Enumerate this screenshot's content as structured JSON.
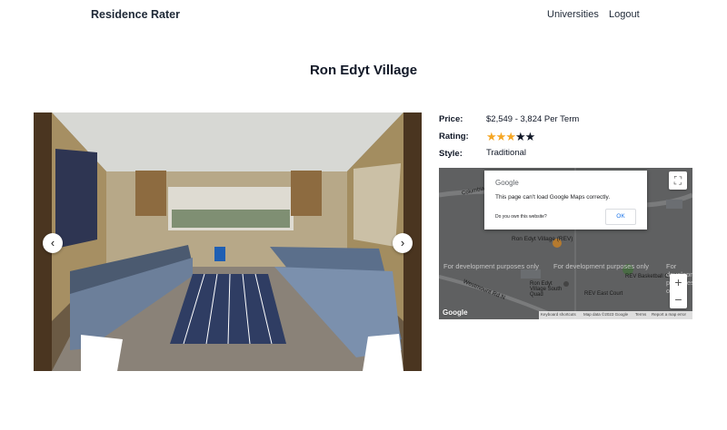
{
  "nav": {
    "brand": "Residence Rater",
    "links": [
      "Universities",
      "Logout"
    ]
  },
  "page": {
    "title": "Ron Edyt Village"
  },
  "carousel": {
    "prev_label": "‹",
    "next_label": "›"
  },
  "details": {
    "price_label": "Price:",
    "price_value": "$2,549 - 3,824 Per Term",
    "rating_label": "Rating:",
    "rating": 3,
    "rating_max": 5,
    "style_label": "Style:",
    "style_value": "Traditional"
  },
  "colors": {
    "star_filled": "#f5a623",
    "star_empty": "#111827"
  },
  "map": {
    "dialog": {
      "brand": "Google",
      "message": "This page can't load Google Maps correctly.",
      "own_site": "Do you own this website?",
      "ok": "OK"
    },
    "dev_watermark": "For development purposes only",
    "places": {
      "village": "Ron Edyt Village (REV)",
      "south_quad": "Ron Edyt Village South Quad",
      "east_court": "REV East Court",
      "basketball": "REV Basketball C"
    },
    "roads": {
      "westmount": "Westmount Rd N",
      "columbia": "Columbia"
    },
    "zoom_in": "+",
    "zoom_out": "−",
    "logo": "Google",
    "attribution": {
      "shortcuts": "Keyboard shortcuts",
      "data": "Map data ©2023 Google",
      "terms": "Terms",
      "report": "Report a map error"
    }
  }
}
